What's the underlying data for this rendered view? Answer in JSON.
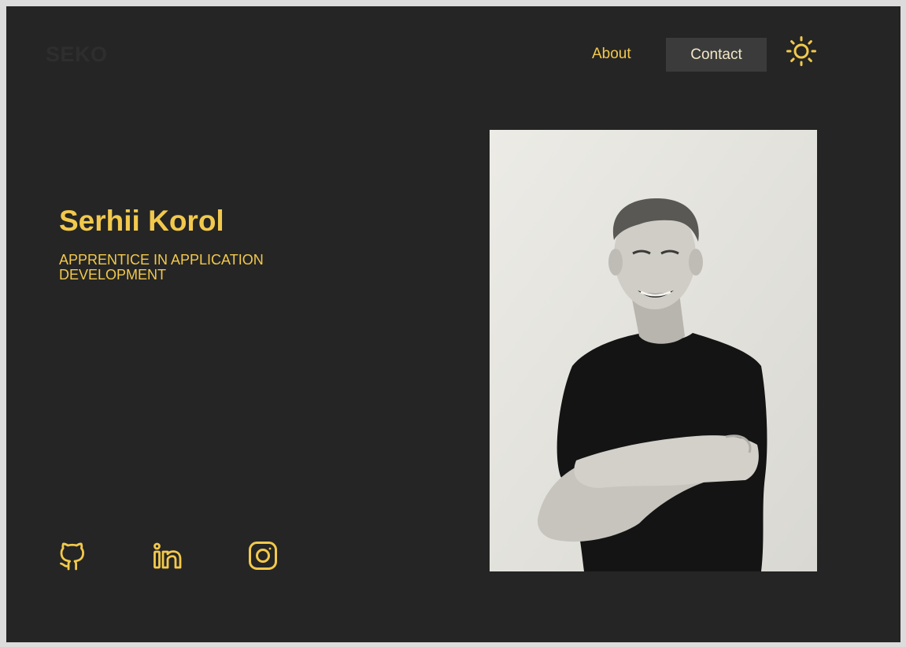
{
  "logo": "SEKO",
  "nav": {
    "about": "About",
    "contact": "Contact"
  },
  "theme_toggle_icon": "sun-icon",
  "hero": {
    "name": "Serhii Korol",
    "role": "APPRENTICE IN APPLICATION DEVELOPMENT"
  },
  "socials": [
    {
      "icon": "github-icon"
    },
    {
      "icon": "linkedin-icon"
    },
    {
      "icon": "instagram-icon"
    }
  ],
  "photo": {
    "icon": "portrait-photo"
  },
  "colors": {
    "background": "#252525",
    "accent": "#f2c94c",
    "contact_button_bg": "#3a3b3a",
    "logo": "#2e2e2e"
  }
}
